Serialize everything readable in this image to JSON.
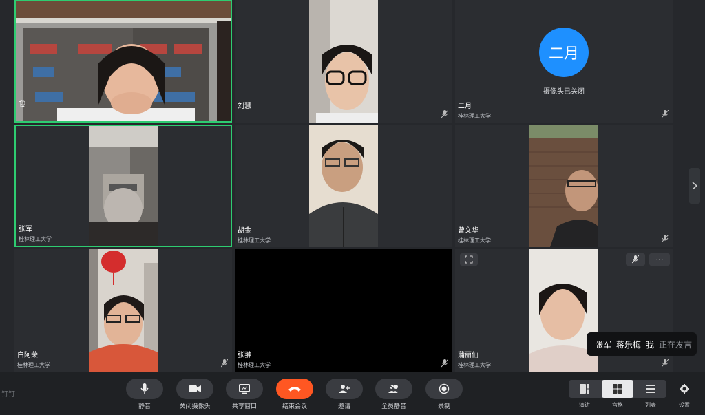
{
  "tiles": [
    {
      "name": "我",
      "org": ""
    },
    {
      "name": "刘慧",
      "org": ""
    },
    {
      "name": "二月",
      "org": "桂林理工大学",
      "avatar": "二月",
      "cam_off": "摄像头已关闭"
    },
    {
      "name": "张军",
      "org": "桂林理工大学"
    },
    {
      "name": "胡金",
      "org": "桂林理工大学"
    },
    {
      "name": "曾文华",
      "org": "桂林理工大学"
    },
    {
      "name": "白阿荣",
      "org": "桂林理工大学"
    },
    {
      "name": "张翀",
      "org": "桂林理工大学"
    },
    {
      "name": "蒲丽仙",
      "org": "桂林理工大学"
    }
  ],
  "tile_menu": "···",
  "speaking": {
    "names": [
      "张军",
      "蒋乐梅",
      "我"
    ],
    "suffix": "正在发言"
  },
  "brand": "钉钉",
  "toolbar": {
    "mute": "静音",
    "camera_off": "关闭摄像头",
    "share": "共享窗口",
    "end": "结束会议",
    "invite": "邀请",
    "mute_all": "全员静音",
    "record": "录制"
  },
  "layouts": {
    "speaker": "演讲",
    "grid": "宫格",
    "list": "列表",
    "selected": "grid"
  },
  "settings": "设置",
  "colors": {
    "active_border": "#2ecc71",
    "avatar_blue": "#1e90ff",
    "end_call": "#ff5722"
  }
}
